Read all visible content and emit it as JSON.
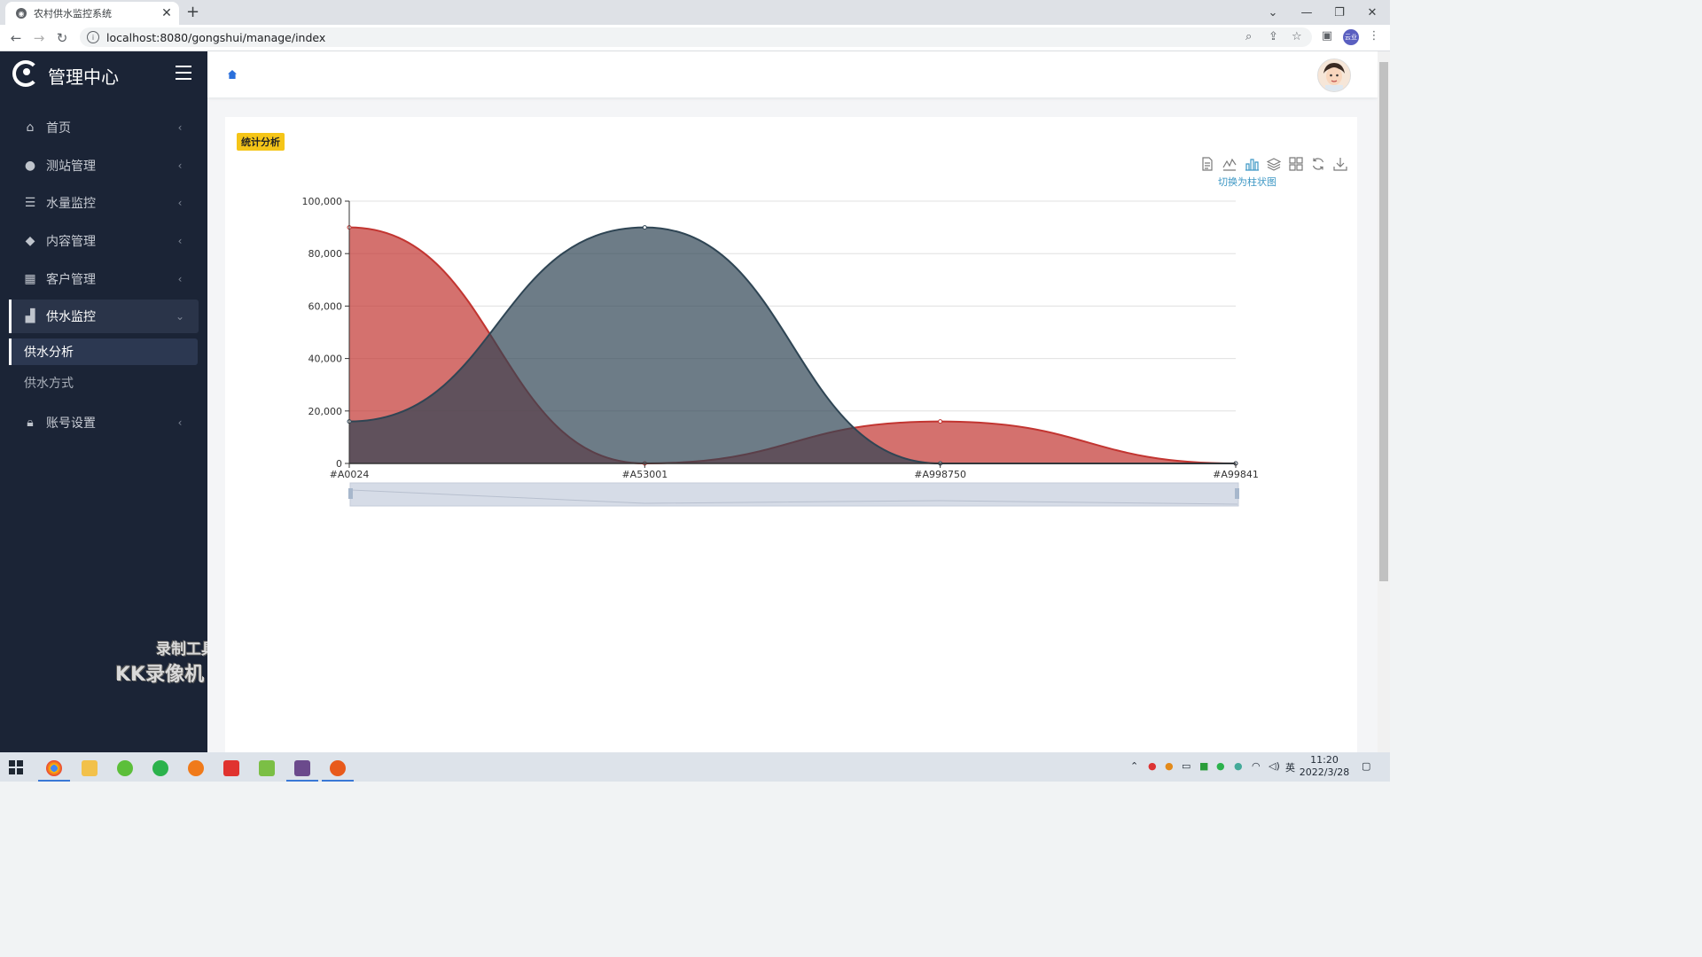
{
  "browser": {
    "tab_title": "农村供水监控系统",
    "url": "localhost:8080/gongshui/manage/index",
    "profile_label": "云业"
  },
  "sidebar": {
    "brand": "管理中心",
    "items": [
      {
        "label": "首页",
        "icon": "home-icon"
      },
      {
        "label": "测站管理",
        "icon": "droplet-icon"
      },
      {
        "label": "水量监控",
        "icon": "users-icon"
      },
      {
        "label": "内容管理",
        "icon": "tags-icon"
      },
      {
        "label": "客户管理",
        "icon": "grid-icon"
      },
      {
        "label": "供水监控",
        "icon": "bar-chart-icon",
        "expanded": true
      }
    ],
    "sub_items": [
      "供水分析",
      "供水方式"
    ],
    "account": {
      "label": "账号设置",
      "icon": "lock-icon"
    },
    "watermark": {
      "line1": "录制工具",
      "line2": "KK录像机"
    }
  },
  "card": {
    "badge": "统计分析",
    "toolbox_tooltip": "切换为柱状图",
    "toolbox": [
      "data-view-icon",
      "line-chart-icon",
      "bar-chart-icon",
      "stack-icon",
      "tiled-icon",
      "restore-icon",
      "download-icon"
    ]
  },
  "chart_data": {
    "type": "area",
    "smooth": true,
    "categories": [
      "#A0024",
      "#A53001",
      "#A998750",
      "#A99841"
    ],
    "ylim": [
      0,
      100000
    ],
    "yticks": [
      "0",
      "20,000",
      "40,000",
      "60,000",
      "80,000",
      "100,000"
    ],
    "grid": true,
    "series": [
      {
        "values": [
          90000,
          0,
          16000,
          0
        ],
        "color": "#c23531"
      },
      {
        "values": [
          16000,
          90000,
          0,
          0
        ],
        "color": "#2f4554"
      }
    ],
    "datazoom": true
  },
  "taskbar": {
    "time": "11:20",
    "date": "2022/3/28",
    "ime": "英"
  }
}
